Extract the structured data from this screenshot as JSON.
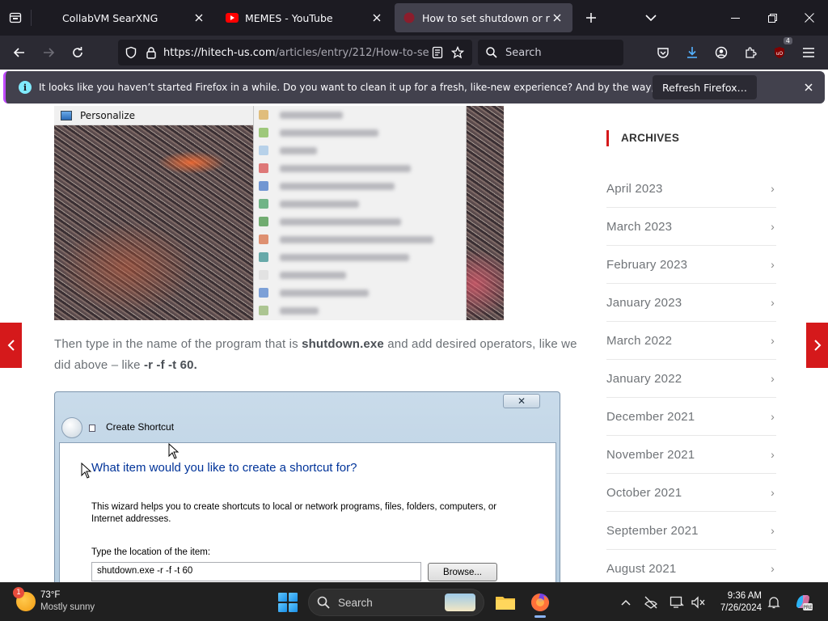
{
  "browser": {
    "tabs": [
      {
        "title": "CollabVM SearXNG",
        "active": false
      },
      {
        "title": "MEMES - YouTube",
        "active": false
      },
      {
        "title": "How to set shutdown or restart",
        "active": true
      }
    ],
    "url_host": "https://hitech-us.com",
    "url_path": "/articles/entry/212/How-to-se",
    "search_placeholder": "Search",
    "ublock_count": "4"
  },
  "notification": {
    "message": "It looks like you haven’t started Firefox in a while. Do you want to clean it up for a fresh, like-new experience? And by the way, welcome back!",
    "button_label": "Refresh Firefox…"
  },
  "article": {
    "context_menu_first": "Personalize",
    "paragraph_before": "Then type in the name of the program that is ",
    "paragraph_bold1": "shutdown.exe",
    "paragraph_middle": " and add desired operators, like we did above – like ",
    "paragraph_bold2": "-r -f -t 60.",
    "dialog": {
      "title": "Create Shortcut",
      "close_glyph": "✕",
      "heading": "What item would you like to create a shortcut for?",
      "description": "This wizard helps you to create shortcuts to local or network programs, files, folders, computers, or Internet addresses.",
      "location_label": "Type the location of the item:",
      "location_value": "shutdown.exe -r -f -t 60",
      "browse_label": "Browse..."
    }
  },
  "sidebar": {
    "title": "ARCHIVES",
    "items": [
      {
        "label": "April 2023"
      },
      {
        "label": "March 2023"
      },
      {
        "label": "February 2023"
      },
      {
        "label": "January 2023"
      },
      {
        "label": "March 2022"
      },
      {
        "label": "January 2022"
      },
      {
        "label": "December 2021"
      },
      {
        "label": "November 2021"
      },
      {
        "label": "October 2021"
      },
      {
        "label": "September 2021"
      },
      {
        "label": "August 2021"
      }
    ]
  },
  "taskbar": {
    "weather_badge": "1",
    "temperature": "73°F",
    "condition": "Mostly sunny",
    "search_label": "Search",
    "time": "9:36 AM",
    "date": "7/26/2024"
  },
  "colors": {
    "accent_red": "#d5191b",
    "browser_dark": "#1c1b22",
    "notification_bg": "#42414d"
  }
}
